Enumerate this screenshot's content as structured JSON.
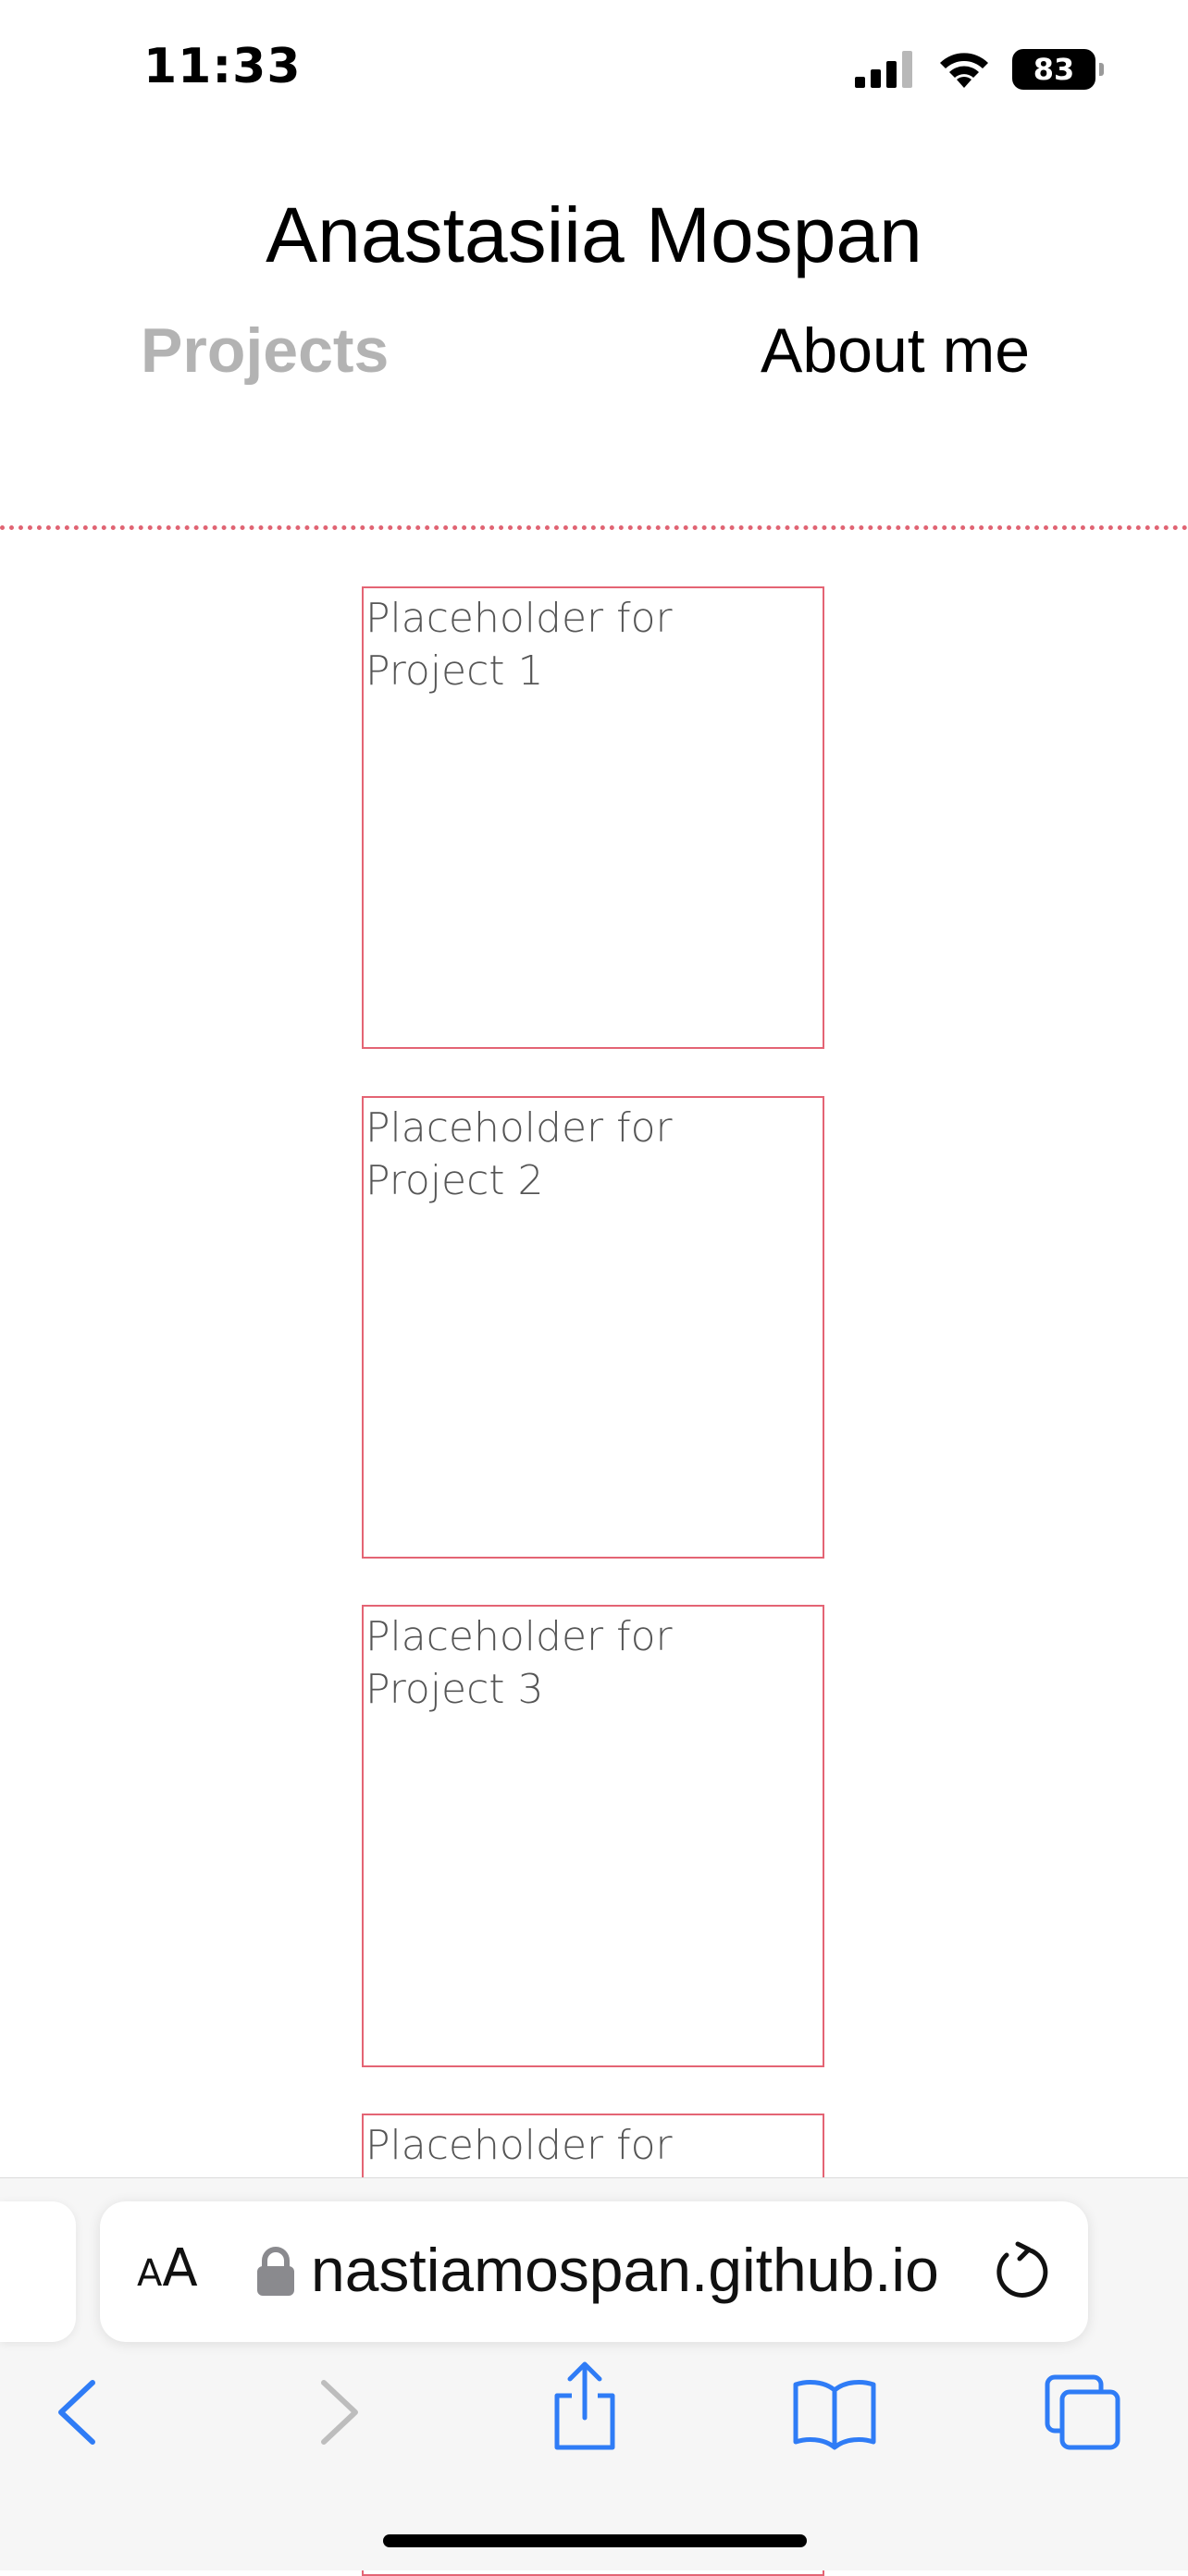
{
  "status_bar": {
    "time": "11:33",
    "battery": "83",
    "icons": [
      "cellular-signal-icon",
      "wifi-icon",
      "battery-icon"
    ]
  },
  "header": {
    "title": "Anastasiia Mospan",
    "nav": {
      "projects": "Projects",
      "about": "About me"
    }
  },
  "projects": [
    {
      "label": "Placeholder for Project 1"
    },
    {
      "label": "Placeholder for Project 2"
    },
    {
      "label": "Placeholder for Project 3"
    },
    {
      "label": "Placeholder for"
    }
  ],
  "browser": {
    "text_size_label_small": "A",
    "text_size_label_large": "A",
    "url": "nastiamospan.github.io",
    "toolbar_icons": [
      "back-icon",
      "forward-icon",
      "share-icon",
      "bookmarks-icon",
      "tabs-icon"
    ]
  },
  "colors": {
    "accent": "#e46474",
    "nav_inactive": "#b3b3b3",
    "link_blue": "#2f7cf6"
  }
}
